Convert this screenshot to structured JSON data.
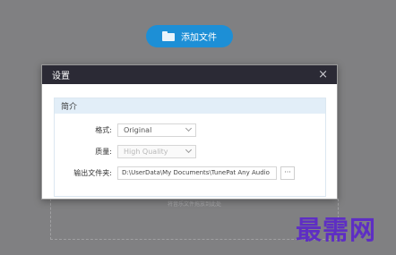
{
  "background": {
    "add_file_label": "添加文件",
    "drop_hint": "将音乐文件拖放到此处"
  },
  "dialog": {
    "title": "设置",
    "close_glyph": "×",
    "section_title": "简介",
    "format": {
      "label": "格式:",
      "value": "Original"
    },
    "quality": {
      "label": "质量:",
      "value": "High Quality"
    },
    "output": {
      "label": "输出文件夹:",
      "value": "D:\\UserData\\My Documents\\TunePat Any Audio",
      "browse_label": "···"
    }
  },
  "watermark": "最需网",
  "colors": {
    "accent": "#1d8fd6",
    "titlebar": "#2b2a35",
    "section_header": "#e2eef8",
    "watermark": "#5e2ec4"
  }
}
